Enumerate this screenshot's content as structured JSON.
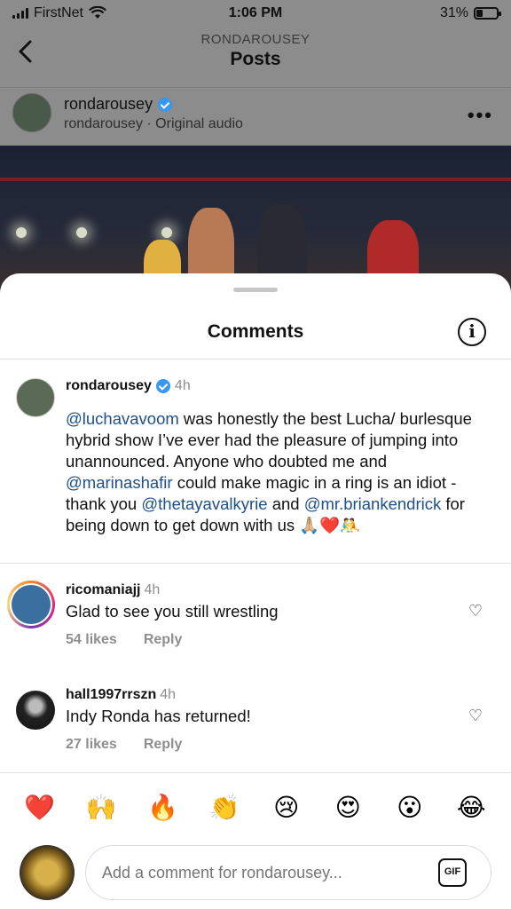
{
  "status_bar": {
    "carrier": "FirstNet",
    "time": "1:06 PM",
    "battery": "31%"
  },
  "header": {
    "subtitle": "RONDAROUSEY",
    "title": "Posts"
  },
  "post": {
    "username": "rondarousey",
    "subline": "rondarousey · Original audio",
    "more": "•••"
  },
  "sheet": {
    "title": "Comments",
    "info_icon": "info-icon"
  },
  "caption": {
    "username": "rondarousey",
    "time": "4h",
    "segments": [
      {
        "type": "mention",
        "text": "@luchavavoom"
      },
      {
        "type": "text",
        "text": " was honestly the best Lucha/ burlesque hybrid show I’ve ever had the pleasure of jumping into unannounced. Anyone who doubted me and "
      },
      {
        "type": "mention",
        "text": "@marinashafir"
      },
      {
        "type": "text",
        "text": " could make magic in a ring is an idiot - thank you "
      },
      {
        "type": "mention",
        "text": "@thetayavalkyrie"
      },
      {
        "type": "text",
        "text": " and "
      },
      {
        "type": "mention",
        "text": "@mr.briankendrick"
      },
      {
        "type": "text",
        "text": " for being down to get down with us 🙏🏼❤️🤼"
      }
    ]
  },
  "comments": [
    {
      "username": "ricomaniajj",
      "time": "4h",
      "text": "Glad to see you still wrestling",
      "likes": "54 likes",
      "reply": "Reply"
    },
    {
      "username": "hall1997rrszn",
      "time": "4h",
      "text": "Indy Ronda has returned!",
      "likes": "27 likes",
      "reply": "Reply"
    }
  ],
  "emoji_bar": [
    "❤️",
    "🙌",
    "🔥",
    "👏",
    "😢",
    "😍",
    "😮",
    "😂"
  ],
  "composer": {
    "placeholder": "Add a comment for rondarousey...",
    "gif_label": "GIF"
  }
}
